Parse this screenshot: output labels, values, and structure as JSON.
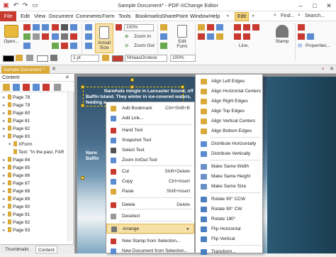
{
  "app": {
    "title": "Sample Document* - PDF-XChange Editor"
  },
  "menubar": {
    "items": [
      "File",
      "Edit",
      "View",
      "Document",
      "Comments",
      "Form",
      "Tools",
      "Bookmarks",
      "SharePoint",
      "Window",
      "Help"
    ],
    "active_tab": "Edit",
    "find_label": "Find...",
    "search_label": "Search..."
  },
  "ribbon": {
    "open_label": "Open...",
    "actual_size_label": "Actual Size",
    "zoom_value": "100%",
    "zoom_in_label": "Zoom In",
    "zoom_out_label": "Zoom Out",
    "edit_label": "Edit Form",
    "line_label": "Line,",
    "stamp_label": "Stamp",
    "properties_label": "Properties...",
    "stroke_width": "1 pt",
    "font_name": "NHaasGrotesk",
    "font_size": "100%"
  },
  "document_tab": {
    "label": "Sample Document *"
  },
  "left_pane": {
    "title": "Content",
    "pages": [
      "Page 78",
      "Page 79",
      "Page 80",
      "Page 81",
      "Page 82",
      "Page 83"
    ],
    "open_page": "Page 83",
    "children": [
      "XForm",
      "Text: \"In the past, FAR"
    ],
    "pages_after": [
      "Page 84",
      "Page 85",
      "Page 86",
      "Page 87",
      "Page 88",
      "Page 89",
      "Page 90",
      "Page 91",
      "Page 92",
      "Page 93"
    ],
    "bottom_tabs": [
      "Thumbnails",
      "Content"
    ]
  },
  "page_text": {
    "line1": "Narwhals mingle in Lancaster Sound, off",
    "line2": "Baffin Island. They winter in ice-covered waters,",
    "line3": "feeding a",
    "line4": "Narw",
    "line5": "Baffin"
  },
  "context_menu": [
    {
      "label": "Add Bookmark",
      "key": "Ctrl+Shift+B",
      "icon": "bookmark-icon"
    },
    {
      "label": "Add Link...",
      "key": "",
      "icon": "link-icon"
    },
    {
      "label": "Hand Tool",
      "key": "",
      "icon": "hand-icon"
    },
    {
      "label": "Snapshot Tool",
      "key": "",
      "icon": "camera-icon"
    },
    {
      "label": "Select Text",
      "key": "",
      "icon": "text-cursor-icon"
    },
    {
      "label": "Zoom In/Out Tool",
      "key": "",
      "icon": "zoom-icon"
    },
    {
      "label": "Cut",
      "key": "Shift+Delete",
      "icon": "scissors-icon"
    },
    {
      "label": "Copy",
      "key": "Ctrl+Insert",
      "icon": "copy-icon"
    },
    {
      "label": "Paste",
      "key": "Shift+Insert",
      "icon": "paste-icon"
    },
    {
      "label": "Delete",
      "key": "Delete",
      "icon": "delete-icon"
    },
    {
      "label": "Deselect",
      "key": "",
      "icon": "deselect-icon"
    },
    {
      "label": "Arrange",
      "key": "",
      "icon": "arrange-icon"
    },
    {
      "label": "New Stamp from Selection...",
      "key": "",
      "icon": "stamp-icon"
    },
    {
      "label": "New Document from Selection...",
      "key": "",
      "icon": "new-doc-icon"
    }
  ],
  "submenu": [
    {
      "label": "Align Left Edges",
      "icon": "align-left-icon"
    },
    {
      "label": "Align Horizontal Centers",
      "icon": "align-hcenter-icon"
    },
    {
      "label": "Align Right Edges",
      "icon": "align-right-icon"
    },
    {
      "label": "Align Top Edges",
      "icon": "align-top-icon"
    },
    {
      "label": "Align Vertical Centers",
      "icon": "align-vcenter-icon"
    },
    {
      "label": "Align Bottom Edges",
      "icon": "align-bottom-icon"
    },
    {
      "label": "Distribute Horizontally",
      "icon": "distribute-h-icon"
    },
    {
      "label": "Distribute Vertically",
      "icon": "distribute-v-icon"
    },
    {
      "label": "Make Same Width",
      "icon": "same-width-icon"
    },
    {
      "label": "Make Same Height",
      "icon": "same-height-icon"
    },
    {
      "label": "Make Same Size",
      "icon": "same-size-icon"
    },
    {
      "label": "Rotate 90° CCW",
      "icon": "rotate-ccw-icon"
    },
    {
      "label": "Rotate 90° CW",
      "icon": "rotate-cw-icon"
    },
    {
      "label": "Rotate 180°",
      "icon": "rotate-180-icon"
    },
    {
      "label": "Flip Horizontal",
      "icon": "flip-h-icon"
    },
    {
      "label": "Flip Vertical",
      "icon": "flip-v-icon"
    },
    {
      "label": "Transform...",
      "icon": "transform-icon"
    }
  ],
  "colors": {
    "accent": "#d9a93a",
    "file_tab": "#c8392f",
    "highlight": "#f7e1a6",
    "page_dark": "#2b5973"
  }
}
